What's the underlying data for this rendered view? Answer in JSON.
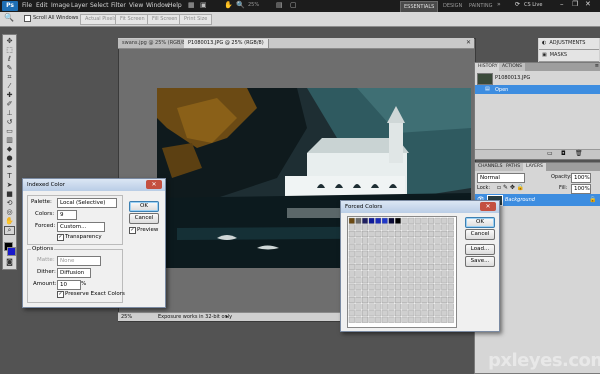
{
  "menubar": {
    "app_logo": "Ps",
    "items": [
      "File",
      "Edit",
      "Image",
      "Layer",
      "Select",
      "Filter",
      "View",
      "Window",
      "Help"
    ],
    "zoom": "25%",
    "workspaces": [
      "ESSENTIALS",
      "DESIGN",
      "PAINTING"
    ],
    "cs_live": "CS Live"
  },
  "options_bar": {
    "scroll_all_windows": "Scroll All Windows",
    "buttons": [
      "Actual Pixels",
      "Fit Screen",
      "Fill Screen",
      "Print Size"
    ]
  },
  "document": {
    "tabs": [
      "swans.jpg @ 25% (RGB/8)",
      "P1080013.JPG @ 25% (RGB/8)"
    ],
    "active_title": "P1080013.JPG @ 25% (RGB/8)",
    "zoom": "25%",
    "status": "Exposure works in 32-bit only"
  },
  "right_mini": {
    "adjustments": "ADJUSTMENTS",
    "masks": "MASKS"
  },
  "history": {
    "tabs": [
      "HISTORY",
      "ACTIONS"
    ],
    "snapshot": "P1080013.JPG",
    "steps": [
      "Open"
    ]
  },
  "layers": {
    "tabs": [
      "CHANNELS",
      "PATHS",
      "LAYERS"
    ],
    "blend_mode": "Normal",
    "opacity_label": "Opacity:",
    "opacity": "100%",
    "lock_label": "Lock:",
    "fill_label": "Fill:",
    "fill": "100%",
    "items": [
      "Background"
    ]
  },
  "indexed_color": {
    "title": "Indexed Color",
    "palette_label": "Palette:",
    "palette_value": "Local (Selective)",
    "colors_label": "Colors:",
    "colors_value": "9",
    "forced_label": "Forced:",
    "forced_value": "Custom...",
    "transparency": "Transparency",
    "options_group": "Options",
    "matte_label": "Matte:",
    "matte_value": "None",
    "dither_label": "Dither:",
    "dither_value": "Diffusion",
    "amount_label": "Amount:",
    "amount_value": "10",
    "amount_unit": "%",
    "preserve": "Preserve Exact Colors",
    "ok": "OK",
    "cancel": "Cancel",
    "preview": "Preview"
  },
  "forced_colors": {
    "title": "Forced Colors",
    "ok": "OK",
    "cancel": "Cancel",
    "load": "Load...",
    "save": "Save...",
    "swatches": [
      "#6b4a14",
      "#6b6b6b",
      "#202060",
      "#0f1a99",
      "#1a2ab5",
      "#2038c8",
      "#0a0a35",
      "#000000"
    ]
  },
  "colors": {
    "foreground": "#000000",
    "background": "#1a1acc",
    "selection": "#3d8de0"
  },
  "watermark": "pxleyes.com"
}
